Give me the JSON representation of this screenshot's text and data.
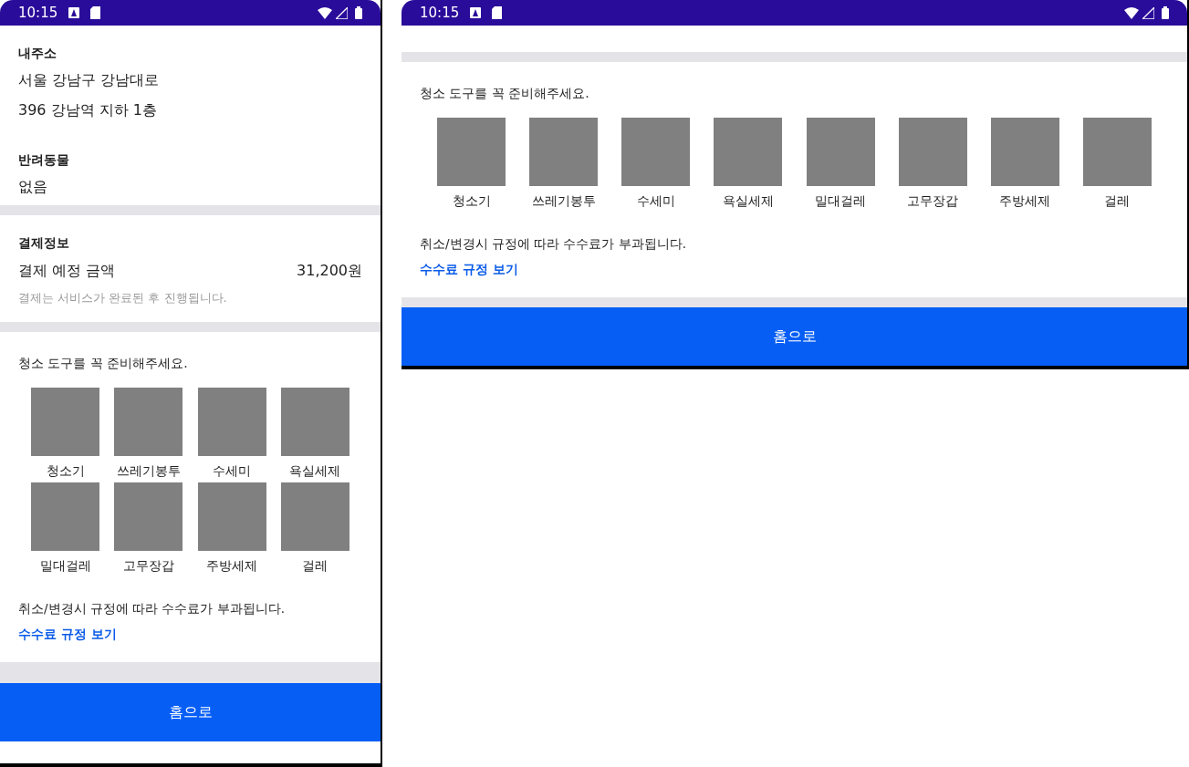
{
  "screens": [
    {
      "status_bar": {
        "time": "10:15"
      },
      "sections": [
        {
          "kind": "info",
          "label": "내주소",
          "lines": [
            "서울 강남구 강남대로",
            "396 강남역 지하 1층"
          ]
        },
        {
          "kind": "info",
          "label": "반려동물",
          "lines": [
            "없음"
          ]
        },
        {
          "kind": "payment",
          "label": "결제정보",
          "amount_label": "결제 예정 금액",
          "amount": "31,200원",
          "note": "결제는 서비스가 완료된 후 진행됩니다."
        },
        {
          "kind": "tools_grid",
          "title": "청소 도구를 꼭 준비해주세요.",
          "tools": [
            "청소기",
            "쓰레기봉투",
            "수세미",
            "욕실세제",
            "밀대걸레",
            "고무장갑",
            "주방세제",
            "걸레"
          ],
          "notice": "취소/변경시 규정에 따라 수수료가 부과됩니다.",
          "link": "수수료 규정 보기"
        }
      ],
      "button": "홈으로"
    },
    {
      "status_bar": {
        "time": "10:15"
      },
      "sections": [
        {
          "kind": "tools_row",
          "title": "청소 도구를 꼭 준비해주세요.",
          "tools": [
            "청소기",
            "쓰레기봉투",
            "수세미",
            "욕실세제",
            "밀대걸레",
            "고무장갑",
            "주방세제",
            "걸레"
          ],
          "notice": "취소/변경시 규정에 따라 수수료가 부과됩니다.",
          "link": "수수료 규정 보기"
        }
      ],
      "button": "홈으로"
    }
  ]
}
